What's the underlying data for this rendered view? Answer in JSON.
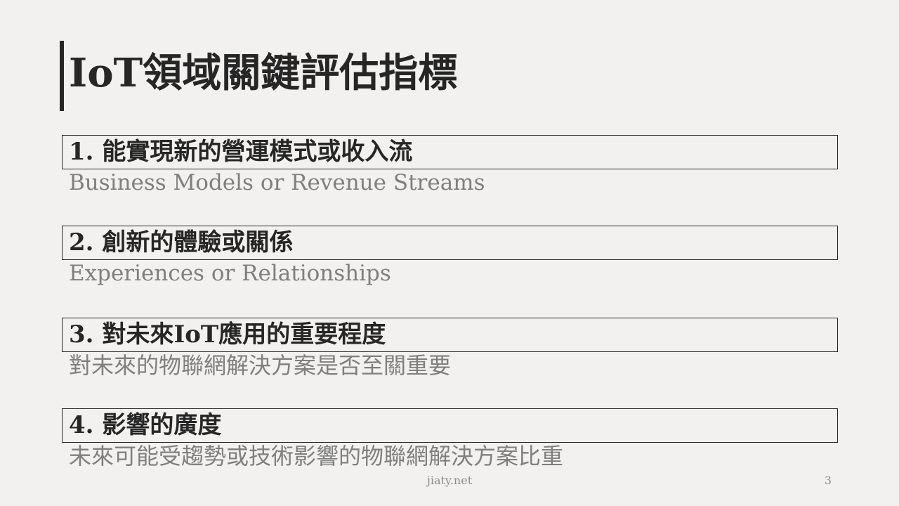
{
  "slide": {
    "title": "IoT領域關鍵評估指標",
    "items": [
      {
        "heading": "1. 能實現新的營運模式或收入流",
        "subtitle": "Business Models or Revenue Streams"
      },
      {
        "heading": "2. 創新的體驗或關係",
        "subtitle": "Experiences or Relationships"
      },
      {
        "heading": "3. 對未來IoT應用的重要程度",
        "subtitle": "對未來的物聯網解決方案是否至關重要"
      },
      {
        "heading": "4. 影響的廣度",
        "subtitle": "未來可能受趨勢或技術影響的物聯網解決方案比重"
      }
    ],
    "footer": "jiaty.net",
    "page_number": "3"
  },
  "colors": {
    "background": "#f2f1ef",
    "text_dark": "#262626",
    "text_muted": "#7f7f7f"
  }
}
